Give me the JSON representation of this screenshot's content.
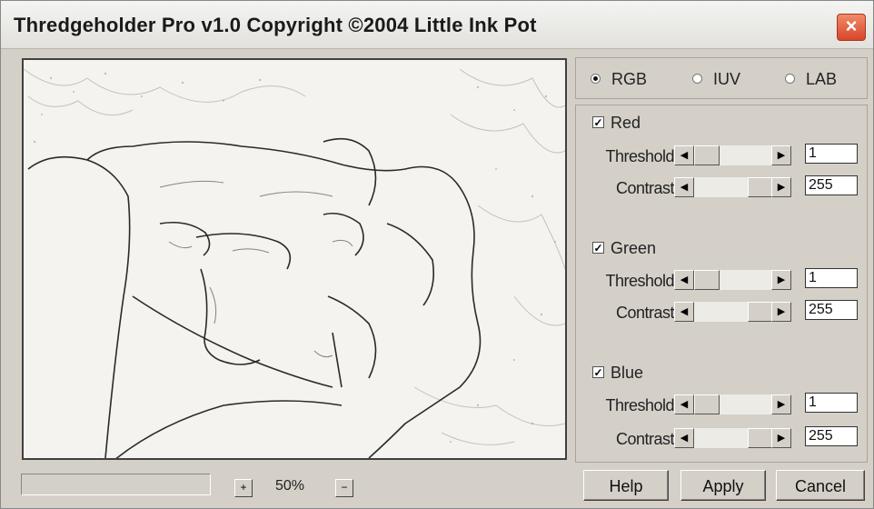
{
  "window": {
    "title": "Thredgeholder Pro v1.0  Copyright ©2004 Little Ink Pot",
    "close_icon": "close-icon"
  },
  "color_space": {
    "options": [
      "RGB",
      "IUV",
      "LAB"
    ],
    "selected": "RGB"
  },
  "channels": [
    {
      "name": "Red",
      "checked": true,
      "threshold_label": "Threshold",
      "threshold_value": "1",
      "contrast_label": "Contrast",
      "contrast_value": "255"
    },
    {
      "name": "Green",
      "checked": true,
      "threshold_label": "Threshold",
      "threshold_value": "1",
      "contrast_label": "Contrast",
      "contrast_value": "255"
    },
    {
      "name": "Blue",
      "checked": true,
      "threshold_label": "Threshold",
      "threshold_value": "1",
      "contrast_label": "Contrast",
      "contrast_value": "255"
    }
  ],
  "zoom": {
    "value": "50%",
    "zoom_in_symbol": "+",
    "zoom_out_symbol": "−"
  },
  "buttons": {
    "help": "Help",
    "apply": "Apply",
    "cancel": "Cancel"
  }
}
